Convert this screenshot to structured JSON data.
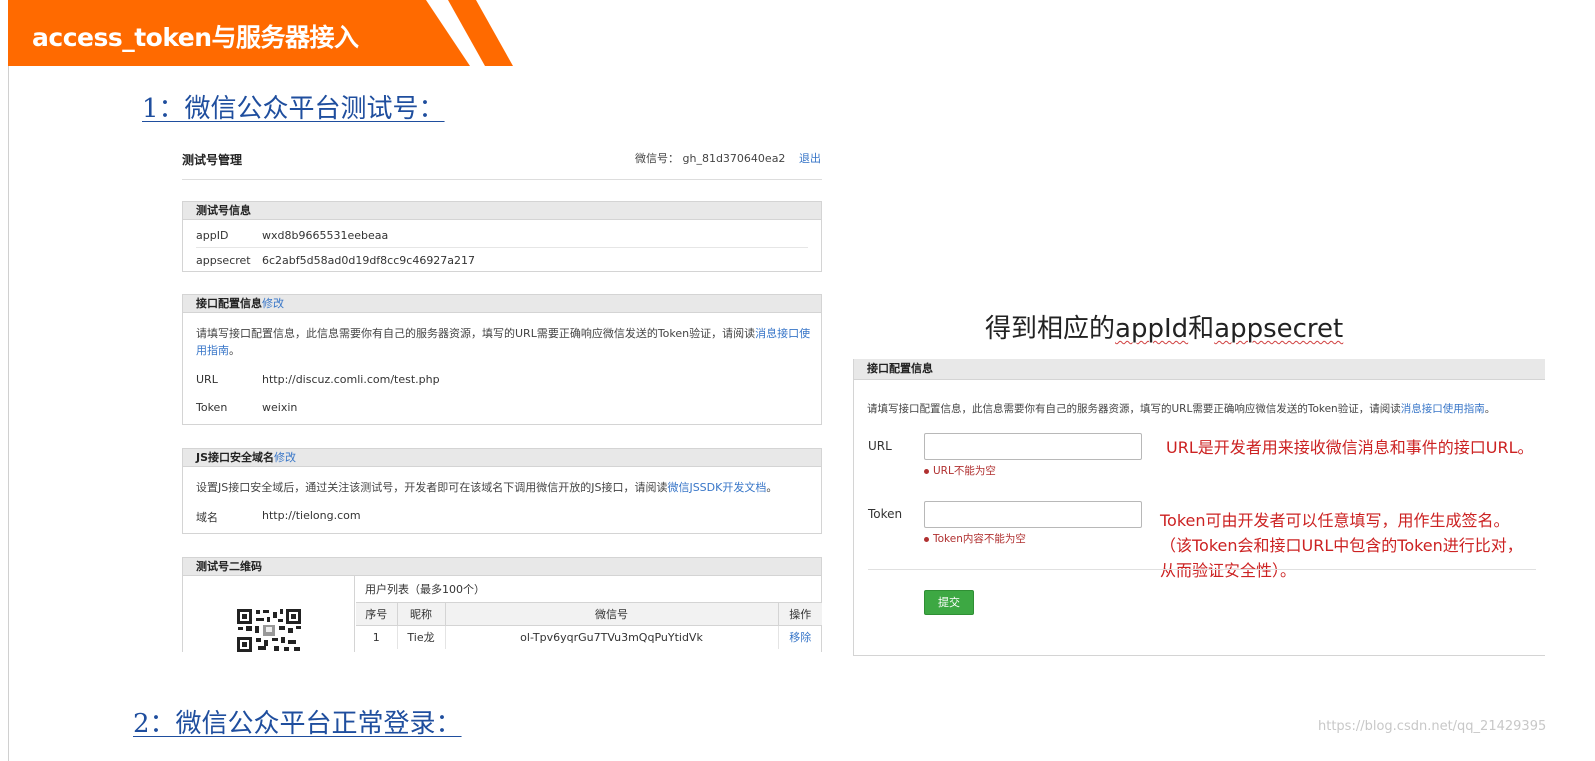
{
  "banner": {
    "title": "access_token与服务器接入"
  },
  "headings": {
    "step1": "1：微信公众平台测试号：",
    "step2": "2：微信公众平台正常登录："
  },
  "test_panel": {
    "title": "测试号管理",
    "wx_label": "微信号：",
    "wx_id": "gh_81d370640ea2",
    "logout": "退出",
    "info": {
      "header": "测试号信息",
      "appid_label": "appID",
      "appid_value": "wxd8b9665531eebeaa",
      "secret_label": "appsecret",
      "secret_value": "6c2abf5d58ad0d19df8cc9c46927a217"
    },
    "iface": {
      "header": "接口配置信息",
      "edit": "修改",
      "desc": "请填写接口配置信息，此信息需要你有自己的服务器资源，填写的URL需要正确响应微信发送的Token验证，请阅读",
      "desc_link": "消息接口使用指南",
      "desc_end": "。",
      "url_label": "URL",
      "url_value": "http://discuz.comli.com/test.php",
      "token_label": "Token",
      "token_value": "weixin"
    },
    "js": {
      "header": "JS接口安全域名",
      "edit": "修改",
      "desc": "设置JS接口安全域后，通过关注该测试号，开发者即可在该域名下调用微信开放的JS接口，请阅读",
      "desc_link": "微信JSSDK开发文档",
      "desc_end": "。",
      "domain_label": "域名",
      "domain_value": "http://tielong.com"
    },
    "qr": {
      "header": "测试号二维码",
      "user_list": "用户列表（最多100个）",
      "columns": [
        "序号",
        "昵称",
        "微信号",
        "操作"
      ],
      "rows": [
        {
          "no": "1",
          "nick": "Tie龙",
          "wxid": "ol-Tpv6yqrGu7TVu3mQqPuYtidVk",
          "op": "移除"
        }
      ]
    }
  },
  "caption": {
    "prefix": "得到相应的",
    "appid": "appId",
    "mid": "和",
    "appsecret": "appsecret"
  },
  "config_panel": {
    "header": "接口配置信息",
    "desc": "请填写接口配置信息，此信息需要你有自己的服务器资源，填写的URL需要正确响应微信发送的Token验证，请阅读",
    "desc_link": "消息接口使用指南",
    "desc_end": "。",
    "url_label": "URL",
    "url_error": "URL不能为空",
    "token_label": "Token",
    "token_error": "Token内容不能为空",
    "submit": "提交",
    "url_note": "URL是开发者用来接收微信消息和事件的接口URL。",
    "token_note_1": "Token可由开发者可以任意填写，用作生成签名。",
    "token_note_2": "（该Token会和接口URL中包含的Token进行比对，",
    "token_note_3": "从而验证安全性）。"
  },
  "watermark": "https://blog.csdn.net/qq_21429395",
  "colors": {
    "banner": "#ff6a00",
    "link": "#3876c8",
    "heading": "#1f4e9e",
    "note": "#cc2222",
    "submit": "#3da843"
  }
}
